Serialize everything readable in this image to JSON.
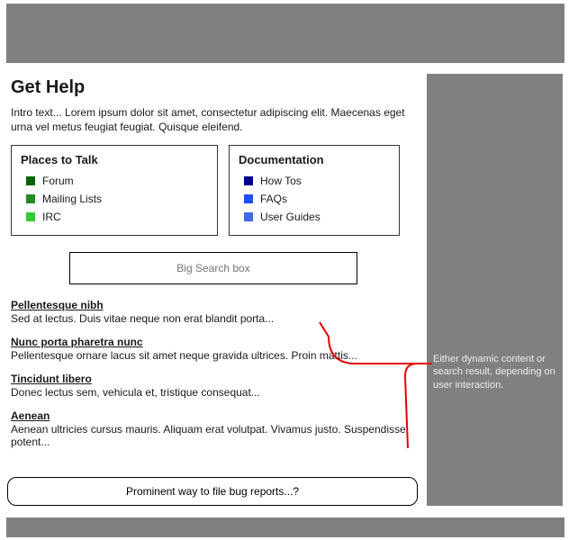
{
  "header": {},
  "footer": {},
  "page_title": "Get Help",
  "intro": "Intro text... Lorem ipsum dolor sit amet, consectetur adipiscing elit. Maecenas eget urna vel metus feugiat feugiat. Quisque eleifend.",
  "boxes": {
    "places": {
      "title": "Places to Talk",
      "items": [
        {
          "label": "Forum",
          "color": "#006400"
        },
        {
          "label": "Mailing Lists",
          "color": "#228B22"
        },
        {
          "label": "IRC",
          "color": "#32CD32"
        }
      ]
    },
    "docs": {
      "title": "Documentation",
      "items": [
        {
          "label": "How Tos",
          "color": "#00008B"
        },
        {
          "label": "FAQs",
          "color": "#1E50FF"
        },
        {
          "label": "User Guides",
          "color": "#4169E1"
        }
      ]
    }
  },
  "search": {
    "placeholder": "Big Search box"
  },
  "results": [
    {
      "title": "Pellentesque nibh",
      "snippet": "Sed at lectus. Duis vitae neque non erat blandit porta..."
    },
    {
      "title": "Nunc porta pharetra nunc",
      "snippet": "Pellentesque ornare lacus sit amet neque gravida ultrices. Proin mattis..."
    },
    {
      "title": "Tincidunt libero",
      "snippet": "Donec lectus sem, vehicula et, tristique consequat..."
    },
    {
      "title": "Aenean",
      "snippet": "Aenean ultricies cursus mauris. Aliquam erat volutpat. Vivamus justo. Suspendisse potent..."
    }
  ],
  "bug_button": "Prominent way to file bug reports...?",
  "annotation": "Either dynamic content or search result, depending on user interaction.",
  "colors": {
    "frame_gray": "#808080",
    "callout_red": "#E60000"
  }
}
